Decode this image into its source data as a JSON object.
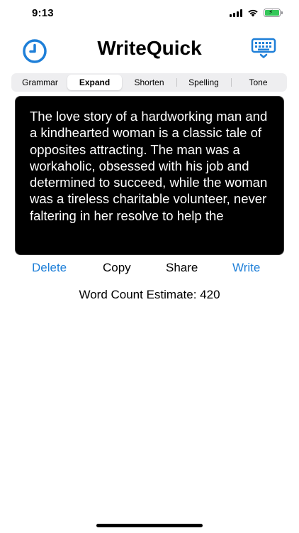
{
  "status_bar": {
    "time": "9:13"
  },
  "header": {
    "title": "WriteQuick",
    "left_icon": "clock-icon",
    "right_icon": "keyboard-icon",
    "accent_color": "#1e7fd8"
  },
  "tabs": [
    {
      "label": "Grammar",
      "selected": false
    },
    {
      "label": "Expand",
      "selected": true
    },
    {
      "label": "Shorten",
      "selected": false
    },
    {
      "label": "Spelling",
      "selected": false
    },
    {
      "label": "Tone",
      "selected": false
    }
  ],
  "editor": {
    "text": "The love story of a hardworking man and a kindhearted woman is a classic tale of opposites attracting. The man was a workaholic, obsessed with his job and determined to succeed, while the woman was a tireless charitable volunteer, never faltering in her resolve to help the"
  },
  "actions": {
    "delete": "Delete",
    "copy": "Copy",
    "share": "Share",
    "write": "Write"
  },
  "word_count": "Word Count Estimate: 420"
}
